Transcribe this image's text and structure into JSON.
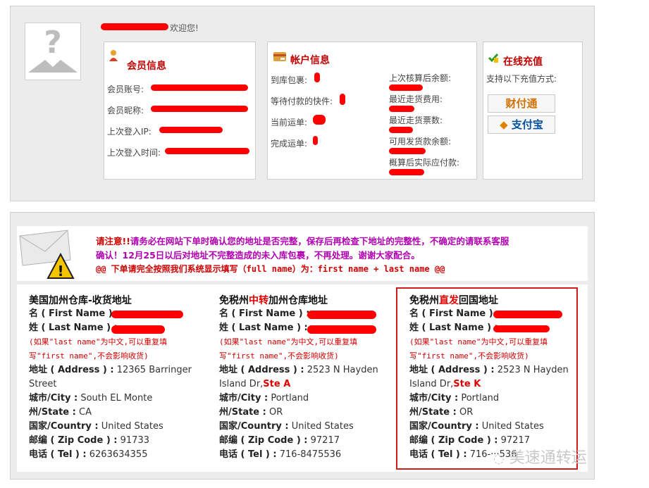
{
  "header": {
    "welcome": "欢迎您!"
  },
  "member": {
    "title": "会员信息",
    "fields": [
      "会员账号:",
      "会员昵称:",
      "上次登入IP:",
      "上次登入时间:"
    ]
  },
  "account": {
    "title": "帐户信息",
    "left_fields": [
      "到库包裹:",
      "等待付款的快件:",
      "当前运单:",
      "完成运单:"
    ],
    "right_fields": [
      "上次核算后余额:",
      "最近走货费用:",
      "最近走货票数:",
      "可用发货款余额:",
      "概算后实际应付款:"
    ]
  },
  "recharge": {
    "title": "在线充值",
    "desc": "支持以下充值方式:",
    "tenpay": "财付通",
    "alipay": "支付宝"
  },
  "notice": {
    "line1_prefix": "请注意!!",
    "line1": "请务必在网站下单时确认您的地址是否完整，保存后再检查下地址的完整性，不确定的请联系客服",
    "line2": "确认！12月25日以后对地址不完整造成的未入库包裹，不再处理。谢谢大家配合。",
    "line3": "@@ 下单请完全按照我们系统显示填写（full name）为：first name + last name @@"
  },
  "addresses": [
    {
      "title_a": "美国加州仓库-收货地址",
      "title_red": "",
      "title_b": "",
      "first_name": "名 ( First Name ) :",
      "last_name": "姓 ( Last Name ) :",
      "note1": "(如果\"last name\"为中文,可以重复填",
      "note2": "写\"first name\",不会影响收货)",
      "address_label": "地址 ( Address ) :",
      "address1": "12365 Barringer",
      "address2": "Street",
      "suite": "",
      "city_label": "城市/City :",
      "city": "South EL Monte",
      "state_label": "州/State :",
      "state": "CA",
      "country_label": "国家/Country :",
      "country": "United States",
      "zip_label": "邮编 ( Zip Code ) :",
      "zip": "91733",
      "tel_label": "电话 ( Tel ) :",
      "tel": "6263634355"
    },
    {
      "title_a": "免税州",
      "title_red": "中转",
      "title_b": "加州仓库地址",
      "first_name": "名 ( First Name ) :",
      "last_name": "姓 ( Last Name ) :",
      "note1": "(如果\"last name\"为中文,可以重复填",
      "note2": "写\"first name\",不会影响收货)",
      "address_label": "地址 ( Address ) :",
      "address1": "2523 N Hayden",
      "address2": "Island Dr,",
      "suite": "Ste A",
      "city_label": "城市/City :",
      "city": "Portland",
      "state_label": "州/State :",
      "state": "OR",
      "country_label": "国家/Country :",
      "country": "United States",
      "zip_label": "邮编 ( Zip Code ) :",
      "zip": "97217",
      "tel_label": "电话 ( Tel ) :",
      "tel": "716-8475536"
    },
    {
      "title_a": "免税州",
      "title_red": "直发",
      "title_b": "回国地址",
      "first_name": "名 ( First Name ) :",
      "last_name": "姓 ( Last Name ) :",
      "note1": "(如果\"last name\"为中文,可以重复填",
      "note2": "写\"first name\",不会影响收货)",
      "address_label": "地址 ( Address ) :",
      "address1": "2523 N Hayden",
      "address2": "Island Dr,",
      "suite": "Ste K",
      "city_label": "城市/City :",
      "city": "Portland",
      "state_label": "州/State :",
      "state": "OR",
      "country_label": "国家/Country :",
      "country": "United States",
      "zip_label": "邮编 ( Zip Code ) :",
      "zip": "97217",
      "tel_label": "电话 ( Tel ) :",
      "tel": "716-···536"
    }
  ],
  "watermark": "美速通转运",
  "colors": {
    "accent": "#c00000",
    "notice": "#b000b0",
    "redaction": "#ff0000",
    "highlight": "#d41b1b"
  }
}
